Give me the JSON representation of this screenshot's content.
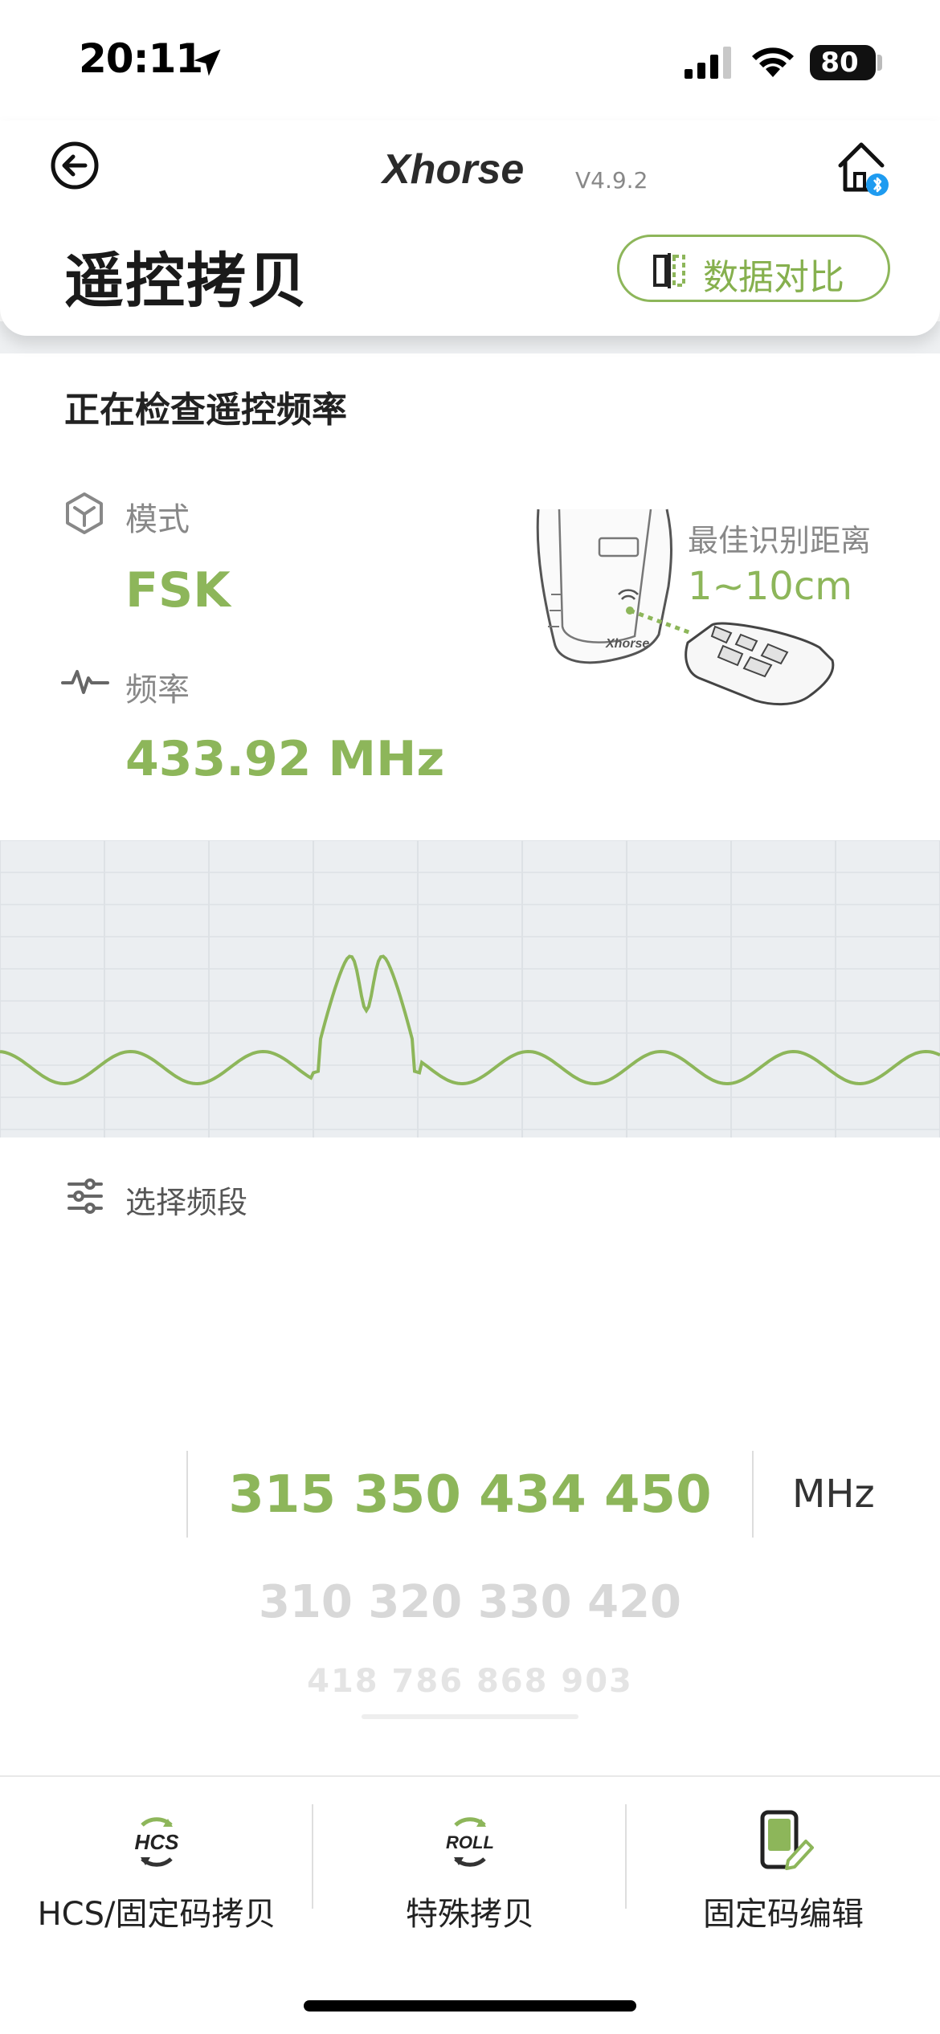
{
  "status_bar": {
    "time": "20:11",
    "battery": "80"
  },
  "header": {
    "logo_text": "Xhorse",
    "version": "V4.9.2",
    "title": "遥控拷贝",
    "compare_button": "数据对比"
  },
  "detection": {
    "status": "正在检查遥控频率",
    "mode_label": "模式",
    "mode_value": "FSK",
    "frequency_label": "频率",
    "frequency_value": "433.92 MHz",
    "distance_label": "最佳识别距离",
    "distance_value": "1~10cm"
  },
  "band_selector": {
    "label": "选择频段",
    "rows": [
      "315 350 434 450",
      "310 320 330 420",
      "418 786 868 903"
    ],
    "unit": "MHz"
  },
  "bottom_nav": [
    {
      "icon": "HCS",
      "label": "HCS/固定码拷贝"
    },
    {
      "icon": "ROLL",
      "label": "特殊拷贝"
    },
    {
      "icon": "edit-device-icon",
      "label": "固定码编辑"
    }
  ],
  "colors": {
    "accent": "#8db65a",
    "wave_bg": "#ebeef1"
  }
}
